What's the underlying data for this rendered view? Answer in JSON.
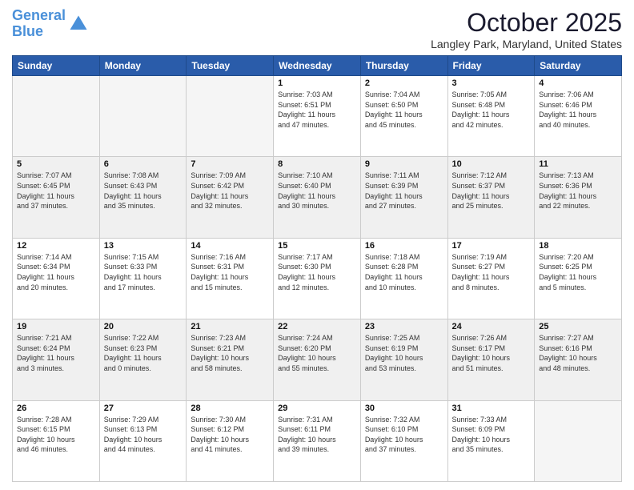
{
  "header": {
    "logo_line1": "General",
    "logo_line2": "Blue",
    "month_title": "October 2025",
    "location": "Langley Park, Maryland, United States"
  },
  "weekdays": [
    "Sunday",
    "Monday",
    "Tuesday",
    "Wednesday",
    "Thursday",
    "Friday",
    "Saturday"
  ],
  "weeks": [
    [
      {
        "day": "",
        "info": "",
        "empty": true
      },
      {
        "day": "",
        "info": "",
        "empty": true
      },
      {
        "day": "",
        "info": "",
        "empty": true
      },
      {
        "day": "1",
        "info": "Sunrise: 7:03 AM\nSunset: 6:51 PM\nDaylight: 11 hours\nand 47 minutes."
      },
      {
        "day": "2",
        "info": "Sunrise: 7:04 AM\nSunset: 6:50 PM\nDaylight: 11 hours\nand 45 minutes."
      },
      {
        "day": "3",
        "info": "Sunrise: 7:05 AM\nSunset: 6:48 PM\nDaylight: 11 hours\nand 42 minutes."
      },
      {
        "day": "4",
        "info": "Sunrise: 7:06 AM\nSunset: 6:46 PM\nDaylight: 11 hours\nand 40 minutes."
      }
    ],
    [
      {
        "day": "5",
        "info": "Sunrise: 7:07 AM\nSunset: 6:45 PM\nDaylight: 11 hours\nand 37 minutes."
      },
      {
        "day": "6",
        "info": "Sunrise: 7:08 AM\nSunset: 6:43 PM\nDaylight: 11 hours\nand 35 minutes."
      },
      {
        "day": "7",
        "info": "Sunrise: 7:09 AM\nSunset: 6:42 PM\nDaylight: 11 hours\nand 32 minutes."
      },
      {
        "day": "8",
        "info": "Sunrise: 7:10 AM\nSunset: 6:40 PM\nDaylight: 11 hours\nand 30 minutes."
      },
      {
        "day": "9",
        "info": "Sunrise: 7:11 AM\nSunset: 6:39 PM\nDaylight: 11 hours\nand 27 minutes."
      },
      {
        "day": "10",
        "info": "Sunrise: 7:12 AM\nSunset: 6:37 PM\nDaylight: 11 hours\nand 25 minutes."
      },
      {
        "day": "11",
        "info": "Sunrise: 7:13 AM\nSunset: 6:36 PM\nDaylight: 11 hours\nand 22 minutes."
      }
    ],
    [
      {
        "day": "12",
        "info": "Sunrise: 7:14 AM\nSunset: 6:34 PM\nDaylight: 11 hours\nand 20 minutes."
      },
      {
        "day": "13",
        "info": "Sunrise: 7:15 AM\nSunset: 6:33 PM\nDaylight: 11 hours\nand 17 minutes."
      },
      {
        "day": "14",
        "info": "Sunrise: 7:16 AM\nSunset: 6:31 PM\nDaylight: 11 hours\nand 15 minutes."
      },
      {
        "day": "15",
        "info": "Sunrise: 7:17 AM\nSunset: 6:30 PM\nDaylight: 11 hours\nand 12 minutes."
      },
      {
        "day": "16",
        "info": "Sunrise: 7:18 AM\nSunset: 6:28 PM\nDaylight: 11 hours\nand 10 minutes."
      },
      {
        "day": "17",
        "info": "Sunrise: 7:19 AM\nSunset: 6:27 PM\nDaylight: 11 hours\nand 8 minutes."
      },
      {
        "day": "18",
        "info": "Sunrise: 7:20 AM\nSunset: 6:25 PM\nDaylight: 11 hours\nand 5 minutes."
      }
    ],
    [
      {
        "day": "19",
        "info": "Sunrise: 7:21 AM\nSunset: 6:24 PM\nDaylight: 11 hours\nand 3 minutes."
      },
      {
        "day": "20",
        "info": "Sunrise: 7:22 AM\nSunset: 6:23 PM\nDaylight: 11 hours\nand 0 minutes."
      },
      {
        "day": "21",
        "info": "Sunrise: 7:23 AM\nSunset: 6:21 PM\nDaylight: 10 hours\nand 58 minutes."
      },
      {
        "day": "22",
        "info": "Sunrise: 7:24 AM\nSunset: 6:20 PM\nDaylight: 10 hours\nand 55 minutes."
      },
      {
        "day": "23",
        "info": "Sunrise: 7:25 AM\nSunset: 6:19 PM\nDaylight: 10 hours\nand 53 minutes."
      },
      {
        "day": "24",
        "info": "Sunrise: 7:26 AM\nSunset: 6:17 PM\nDaylight: 10 hours\nand 51 minutes."
      },
      {
        "day": "25",
        "info": "Sunrise: 7:27 AM\nSunset: 6:16 PM\nDaylight: 10 hours\nand 48 minutes."
      }
    ],
    [
      {
        "day": "26",
        "info": "Sunrise: 7:28 AM\nSunset: 6:15 PM\nDaylight: 10 hours\nand 46 minutes."
      },
      {
        "day": "27",
        "info": "Sunrise: 7:29 AM\nSunset: 6:13 PM\nDaylight: 10 hours\nand 44 minutes."
      },
      {
        "day": "28",
        "info": "Sunrise: 7:30 AM\nSunset: 6:12 PM\nDaylight: 10 hours\nand 41 minutes."
      },
      {
        "day": "29",
        "info": "Sunrise: 7:31 AM\nSunset: 6:11 PM\nDaylight: 10 hours\nand 39 minutes."
      },
      {
        "day": "30",
        "info": "Sunrise: 7:32 AM\nSunset: 6:10 PM\nDaylight: 10 hours\nand 37 minutes."
      },
      {
        "day": "31",
        "info": "Sunrise: 7:33 AM\nSunset: 6:09 PM\nDaylight: 10 hours\nand 35 minutes."
      },
      {
        "day": "",
        "info": "",
        "empty": true
      }
    ]
  ]
}
